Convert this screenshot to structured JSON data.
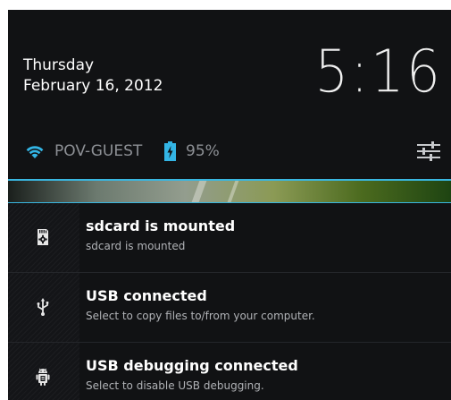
{
  "header": {
    "day": "Thursday",
    "date": "February 16, 2012",
    "time": "5:16"
  },
  "status": {
    "wifi_icon": "wifi-icon",
    "network": "POV-GUEST",
    "battery_icon": "battery-charging-icon",
    "battery_level": "95%",
    "settings_icon": "quick-settings-icon",
    "accent_color": "#33b5e5"
  },
  "notifications": [
    {
      "icon": "sdcard-icon",
      "title": "sdcard is mounted",
      "text": "sdcard is mounted"
    },
    {
      "icon": "usb-icon",
      "title": "USB connected",
      "text": "Select to copy files to/from your computer."
    },
    {
      "icon": "android-debug-icon",
      "title": "USB debugging connected",
      "text": "Select to disable USB debugging."
    }
  ]
}
